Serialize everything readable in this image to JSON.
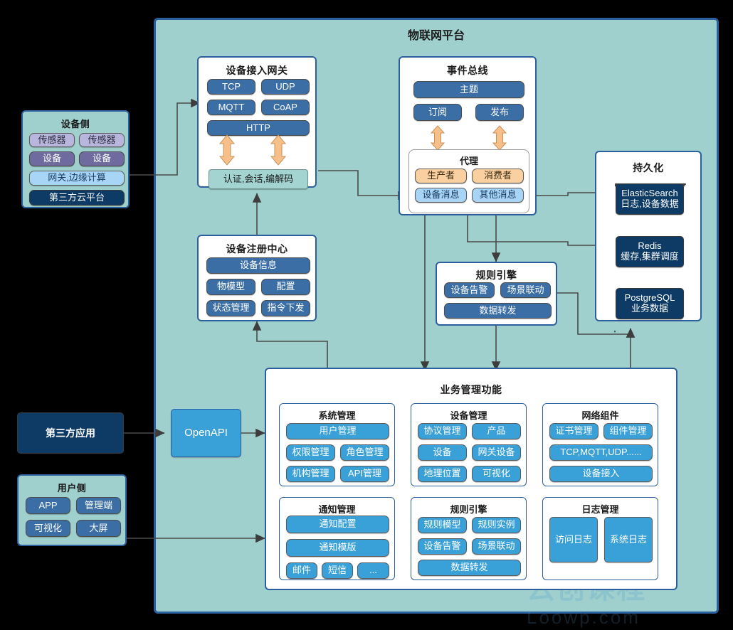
{
  "platform": {
    "title": "物联网平台"
  },
  "device_side": {
    "title": "设备侧",
    "items": [
      {
        "label": "传感器",
        "style": "lav"
      },
      {
        "label": "传感器",
        "style": "lav"
      },
      {
        "label": "设备",
        "style": "purple"
      },
      {
        "label": "设备",
        "style": "purple"
      },
      {
        "label": "网关,边缘计算",
        "style": "lightblue"
      },
      {
        "label": "第三方云平台",
        "style": "dark"
      }
    ]
  },
  "gateway": {
    "title": "设备接入网关",
    "protocols": [
      "TCP",
      "UDP",
      "MQTT",
      "CoAP"
    ],
    "http": "HTTP",
    "auth": "认证,会话,编解码"
  },
  "event_bus": {
    "title": "事件总线",
    "topic": "主题",
    "subscribe": "订阅",
    "publish": "发布",
    "broker": {
      "title": "代理",
      "producer": "生产者",
      "consumer": "消费者",
      "device_message": "设备消息",
      "other_message": "其他消息"
    }
  },
  "registry": {
    "title": "设备注册中心",
    "device_info": "设备信息",
    "items": [
      "物模型",
      "配置",
      "状态管理",
      "指令下发"
    ]
  },
  "rule_engine_mid": {
    "title": "规则引擎",
    "items": [
      "设备告警",
      "场景联动"
    ],
    "wide": "数据转发"
  },
  "persistence": {
    "title": "持久化",
    "stores": [
      {
        "name": "ElasticSearch",
        "desc": "日志,设备数据"
      },
      {
        "name": "Redis",
        "desc": "缓存,集群调度"
      },
      {
        "name": "PostgreSQL",
        "desc": "业务数据"
      }
    ]
  },
  "business": {
    "title": "业务管理功能",
    "groups": [
      {
        "title": "系统管理",
        "wide_top": "用户管理",
        "pairs": [
          [
            "权限管理",
            "角色管理"
          ],
          [
            "机构管理",
            "API管理"
          ]
        ]
      },
      {
        "title": "设备管理",
        "pairs": [
          [
            "协议管理",
            "产品"
          ],
          [
            "设备",
            "网关设备"
          ],
          [
            "地理位置",
            "可视化"
          ]
        ]
      },
      {
        "title": "网络组件",
        "pairs": [
          [
            "证书管理",
            "组件管理"
          ]
        ],
        "wides": [
          "TCP,MQTT,UDP......",
          "设备接入"
        ]
      },
      {
        "title": "通知管理",
        "wides": [
          "通知配置",
          "通知模版"
        ],
        "triple": [
          "邮件",
          "短信",
          "..."
        ]
      },
      {
        "title": "规则引擎",
        "pairs": [
          [
            "规则模型",
            "规则实例"
          ],
          [
            "设备告警",
            "场景联动"
          ]
        ],
        "wides": [
          "数据转发"
        ]
      },
      {
        "title": "日志管理",
        "big_pair": [
          "访问日志",
          "系统日志"
        ]
      }
    ]
  },
  "third_party_app": {
    "label": "第三方应用"
  },
  "open_api": {
    "label": "OpenAPI"
  },
  "user_side": {
    "title": "用户侧",
    "items": [
      "APP",
      "管理端",
      "可视化",
      "大屏"
    ]
  },
  "watermark": {
    "top": "云创课程",
    "bottom": "Loowp.com"
  },
  "colors": {
    "platform_bg": "#9fd0cd",
    "border_blue": "#2c5f9e",
    "steel": "#3a6ea5",
    "dark_navy": "#0d3b66",
    "sky": "#3aa0d8",
    "light_blue": "#a8d4f5",
    "orange": "#fbd0a0",
    "arrow_orange": "#f7c08a",
    "wire": "#4a4a4a"
  }
}
